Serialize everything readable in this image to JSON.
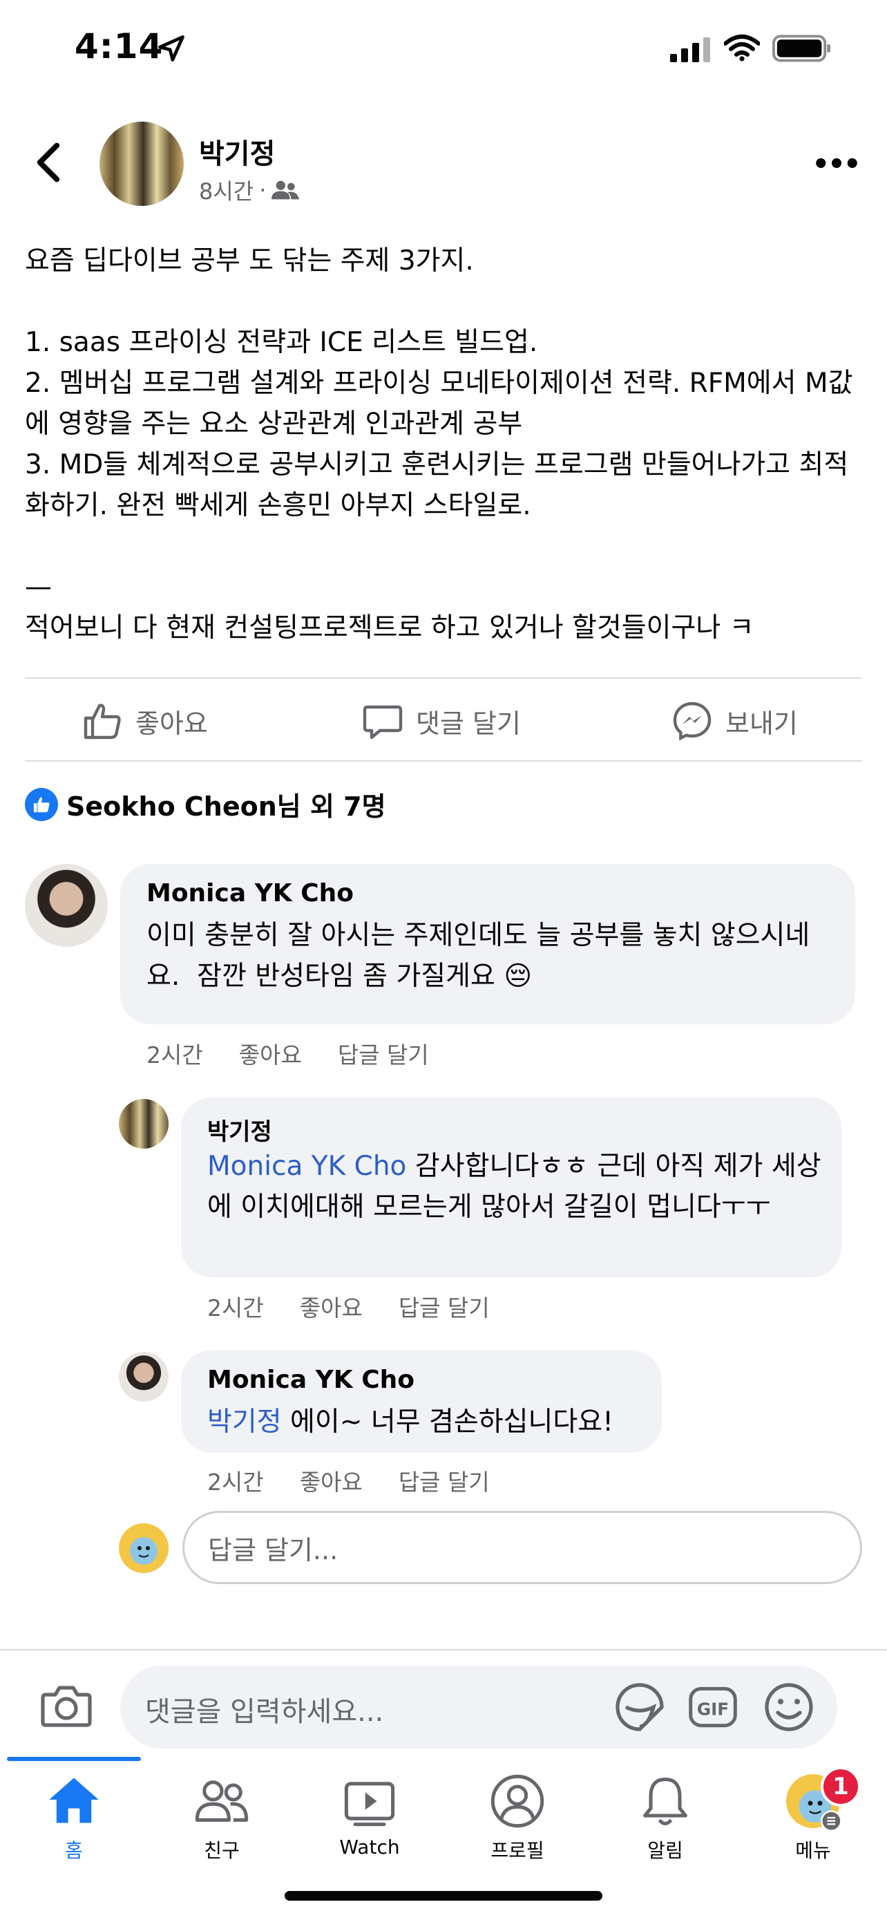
{
  "status_bar": {
    "time": "4:14"
  },
  "post": {
    "author": "박기정",
    "time_ago": "8시간",
    "audience_icon": "friends-icon",
    "body": "요즘 딥다이브 공부 도 닦는 주제 3가지.\n\n1. saas 프라이싱 전략과 ICE 리스트 빌드업.\n2. 멤버십 프로그램 설계와 프라이싱 모네타이제이션 전략. RFM에서 M값에 영향을 주는 요소 상관관계 인과관계 공부\n3. MD들 체계적으로 공부시키고 훈련시키는 프로그램 만들어나가고 최적화하기. 완전 빡세게 손흥민 아부지 스타일로.\n\n—\n적어보니 다 현재 컨설팅프로젝트로 하고 있거나 할것들이구나 ㅋ"
  },
  "actions": {
    "like": "좋아요",
    "comment": "댓글 달기",
    "send": "보내기"
  },
  "reactions": {
    "summary": "Seokho Cheon님 외 7명"
  },
  "comments": [
    {
      "author": "Monica YK Cho",
      "text": "이미 충분히 잘 아시는 주제인데도 늘 공부를 놓치 않으시네요.  잠깐 반성타임 좀 가질게요 😔",
      "time": "2시간",
      "like": "좋아요",
      "reply": "답글 달기"
    },
    {
      "author": "박기정",
      "mention": "Monica YK Cho",
      "text": " 감사합니다ㅎㅎ 근데 아직 제가 세상에 이치에대해 모르는게 많아서 갈길이 멉니다ㅜㅜ",
      "time": "2시간",
      "like": "좋아요",
      "reply": "답글 달기"
    },
    {
      "author": "Monica YK Cho",
      "mention": "박기정",
      "text": " 에이~ 너무 겸손하십니다요!",
      "time": "2시간",
      "like": "좋아요",
      "reply": "답글 달기"
    }
  ],
  "reply_input": {
    "placeholder": "답글 달기..."
  },
  "composer": {
    "placeholder": "댓글을 입력하세요..."
  },
  "tabs": [
    {
      "label": "홈",
      "icon": "home-icon"
    },
    {
      "label": "친구",
      "icon": "friends-icon"
    },
    {
      "label": "Watch",
      "icon": "watch-icon"
    },
    {
      "label": "프로필",
      "icon": "profile-icon"
    },
    {
      "label": "알림",
      "icon": "bell-icon"
    },
    {
      "label": "메뉴",
      "icon": "menu-avatar-icon"
    }
  ],
  "menu_badge": "1",
  "colors": {
    "accent": "#1877f2",
    "mention": "#2d5dc8",
    "bubble": "#f0f2f5",
    "badge": "#e41e3f"
  }
}
